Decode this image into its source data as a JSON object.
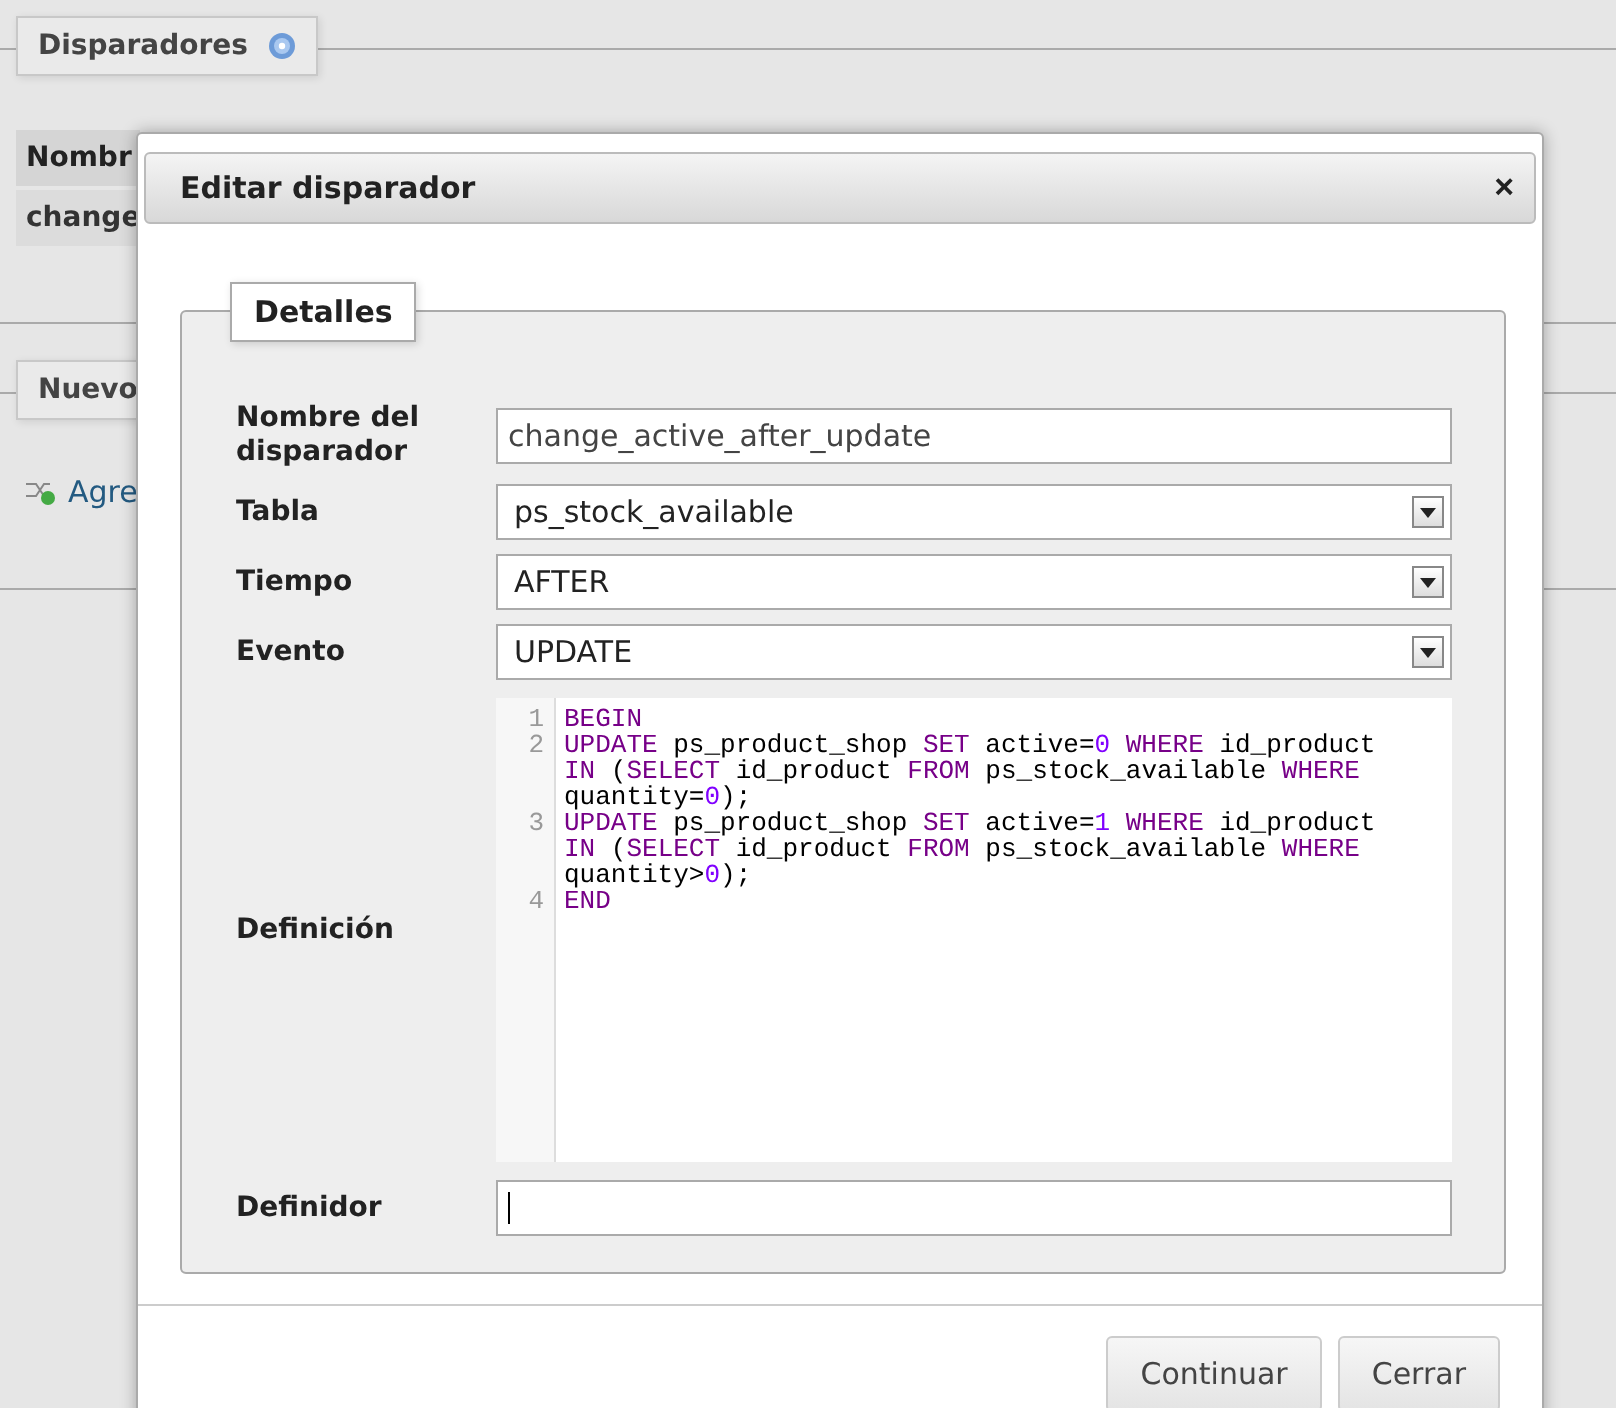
{
  "background": {
    "section_title": "Disparadores",
    "table_header": "Nombr",
    "table_cell": "change",
    "new_section_title": "Nuevo",
    "add_link": "Agre"
  },
  "dialog": {
    "title": "Editar disparador",
    "close": "×",
    "fieldset_legend": "Detalles",
    "fields": [
      {
        "kind": "text",
        "label": "Nombre del disparador",
        "value": "change_active_after_update"
      },
      {
        "kind": "select",
        "label": "Tabla",
        "value": "ps_stock_available"
      },
      {
        "kind": "select",
        "label": "Tiempo",
        "value": "AFTER"
      },
      {
        "kind": "select",
        "label": "Evento",
        "value": "UPDATE"
      },
      {
        "kind": "code",
        "label": "Definición",
        "lines": [
          {
            "number": "1",
            "tokens": [
              {
                "kind": "keyword",
                "text": "BEGIN"
              }
            ]
          },
          {
            "number": "2",
            "tokens": [
              {
                "kind": "keyword",
                "text": "UPDATE"
              },
              {
                "kind": "plain",
                "text": " ps_product_shop "
              },
              {
                "kind": "keyword",
                "text": "SET"
              },
              {
                "kind": "plain",
                "text": " active="
              },
              {
                "kind": "number",
                "text": "0"
              },
              {
                "kind": "keyword",
                "text": " WHERE"
              },
              {
                "kind": "plain",
                "text": " id_product "
              },
              {
                "kind": "keyword",
                "text": "IN"
              },
              {
                "kind": "plain",
                "text": " ("
              },
              {
                "kind": "keyword",
                "text": "SELECT"
              },
              {
                "kind": "plain",
                "text": " id_product "
              },
              {
                "kind": "keyword",
                "text": "FROM"
              },
              {
                "kind": "plain",
                "text": " ps_stock_available "
              },
              {
                "kind": "keyword",
                "text": "WHERE"
              },
              {
                "kind": "plain",
                "text": " quantity="
              },
              {
                "kind": "number",
                "text": "0"
              },
              {
                "kind": "plain",
                "text": ");"
              }
            ]
          },
          {
            "number": "3",
            "tokens": [
              {
                "kind": "keyword",
                "text": "UPDATE"
              },
              {
                "kind": "plain",
                "text": " ps_product_shop "
              },
              {
                "kind": "keyword",
                "text": "SET"
              },
              {
                "kind": "plain",
                "text": " active="
              },
              {
                "kind": "number",
                "text": "1"
              },
              {
                "kind": "keyword",
                "text": " WHERE"
              },
              {
                "kind": "plain",
                "text": " id_product "
              },
              {
                "kind": "keyword",
                "text": "IN"
              },
              {
                "kind": "plain",
                "text": " ("
              },
              {
                "kind": "keyword",
                "text": "SELECT"
              },
              {
                "kind": "plain",
                "text": " id_product "
              },
              {
                "kind": "keyword",
                "text": "FROM"
              },
              {
                "kind": "plain",
                "text": " ps_stock_available "
              },
              {
                "kind": "keyword",
                "text": "WHERE"
              },
              {
                "kind": "plain",
                "text": " quantity>"
              },
              {
                "kind": "number",
                "text": "0"
              },
              {
                "kind": "plain",
                "text": ");"
              }
            ]
          },
          {
            "number": "4",
            "tokens": [
              {
                "kind": "keyword",
                "text": "END"
              }
            ]
          }
        ]
      },
      {
        "kind": "text",
        "label": "Definidor"
      }
    ],
    "buttons": [
      "Continuar",
      "Cerrar"
    ]
  }
}
